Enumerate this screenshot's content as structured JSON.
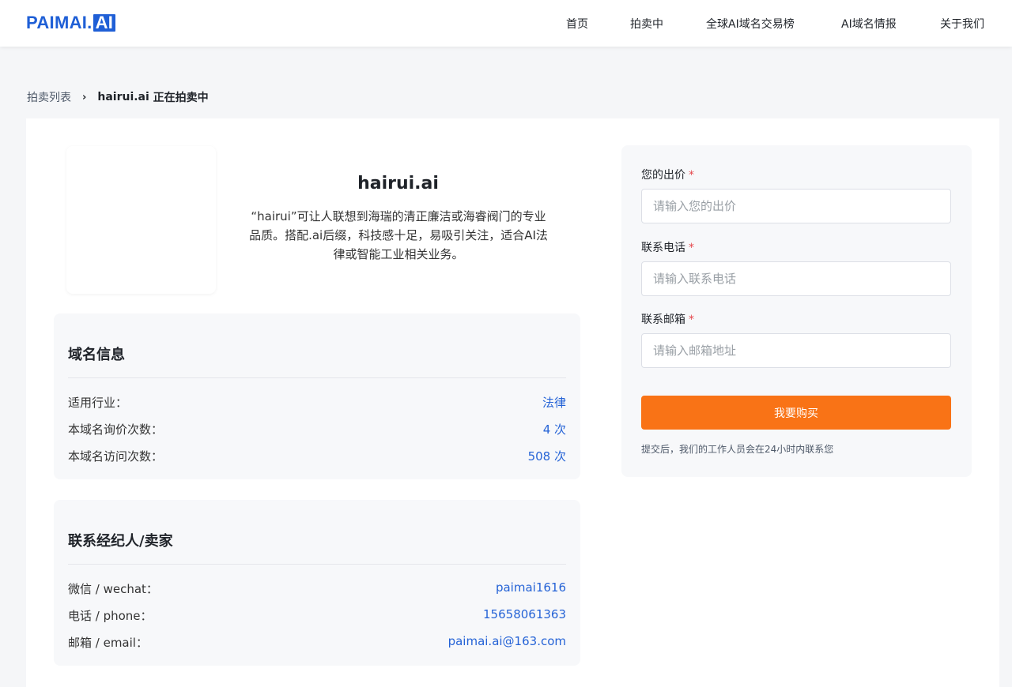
{
  "header": {
    "logo_text": "PAIMAI.",
    "logo_badge": "AI",
    "nav": [
      {
        "label": "首页"
      },
      {
        "label": "拍卖中"
      },
      {
        "label": "全球AI域名交易榜"
      },
      {
        "label": "AI域名情报"
      },
      {
        "label": "关于我们"
      }
    ]
  },
  "breadcrumb": {
    "parent": "拍卖列表",
    "separator": "›",
    "current": "hairui.ai",
    "suffix": " 正在拍卖中"
  },
  "domain": {
    "name": "hairui.ai",
    "description": "“hairui”可让人联想到海瑞的清正廉洁或海睿阀门的专业品质。搭配.ai后缀，科技感十足，易吸引关注，适合AI法律或智能工业相关业务。"
  },
  "domain_info": {
    "title": "域名信息",
    "rows": [
      {
        "label": "适用行业：",
        "value": "法律"
      },
      {
        "label": "本域名询价次数：",
        "value": "4 次"
      },
      {
        "label": "本域名访问次数：",
        "value": "508 次"
      }
    ]
  },
  "contact": {
    "title": "联系经纪人/卖家",
    "rows": [
      {
        "label": "微信 / wechat：",
        "value": "paimai1616"
      },
      {
        "label": "电话 / phone：",
        "value": "15658061363"
      },
      {
        "label": "邮箱 / email：",
        "value": "paimai.ai@163.com"
      }
    ]
  },
  "form": {
    "required_mark": "*",
    "fields": [
      {
        "label": "您的出价",
        "placeholder": "请输入您的出价",
        "value": ""
      },
      {
        "label": "联系电话",
        "placeholder": "请输入联系电话",
        "value": ""
      },
      {
        "label": "联系邮箱",
        "placeholder": "请输入邮箱地址",
        "value": ""
      }
    ],
    "submit_label": "我要购买",
    "note": "提交后，我们的工作人员会在24小时内联系您"
  },
  "colors": {
    "brand": "#1f5fd6",
    "link": "#2563d6",
    "accent_button": "#f97316",
    "required": "#e5484d"
  }
}
